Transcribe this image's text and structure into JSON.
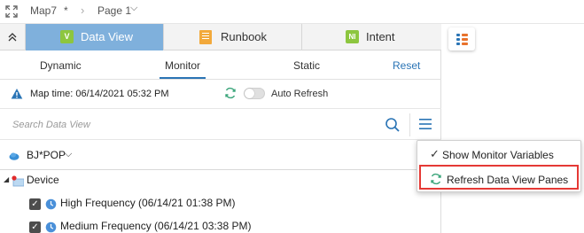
{
  "breadcrumb": {
    "map": "Map7",
    "unsaved_mark": "*",
    "separator": "›",
    "page": "Page 1",
    "page_chevron": "⌵"
  },
  "tabs": [
    {
      "label": "Data View",
      "icon": "V",
      "active": true
    },
    {
      "label": "Runbook",
      "icon": "book-icon",
      "active": false
    },
    {
      "label": "Intent",
      "icon": "NI",
      "active": false
    }
  ],
  "subtabs": {
    "dynamic": "Dynamic",
    "monitor": "Monitor",
    "static": "Static",
    "reset": "Reset",
    "active": "Monitor"
  },
  "map_time": {
    "text": "Map time: 06/14/2021 05:32 PM",
    "auto_refresh_label": "Auto Refresh",
    "auto_refresh_on": false
  },
  "search": {
    "placeholder": "Search Data View",
    "value": ""
  },
  "site": {
    "label": "BJ*POP",
    "chevron": "⌵"
  },
  "tree": {
    "root": {
      "label": "Device",
      "expanded": true
    },
    "items": [
      {
        "label": "High Frequency (06/14/21 01:38 PM)",
        "checked": true
      },
      {
        "label": "Medium Frequency (06/14/21 03:38 PM)",
        "checked": true
      }
    ]
  },
  "context_menu": {
    "items": [
      {
        "label": "Show Monitor Variables",
        "checked": true
      },
      {
        "label": "Refresh Data View Panes",
        "checked": false,
        "highlighted": true
      }
    ]
  },
  "colors": {
    "active_tab": "#7fb0dc",
    "accent": "#2a74b5",
    "badge_green": "#8dc63f",
    "highlight_border": "#e53935"
  }
}
